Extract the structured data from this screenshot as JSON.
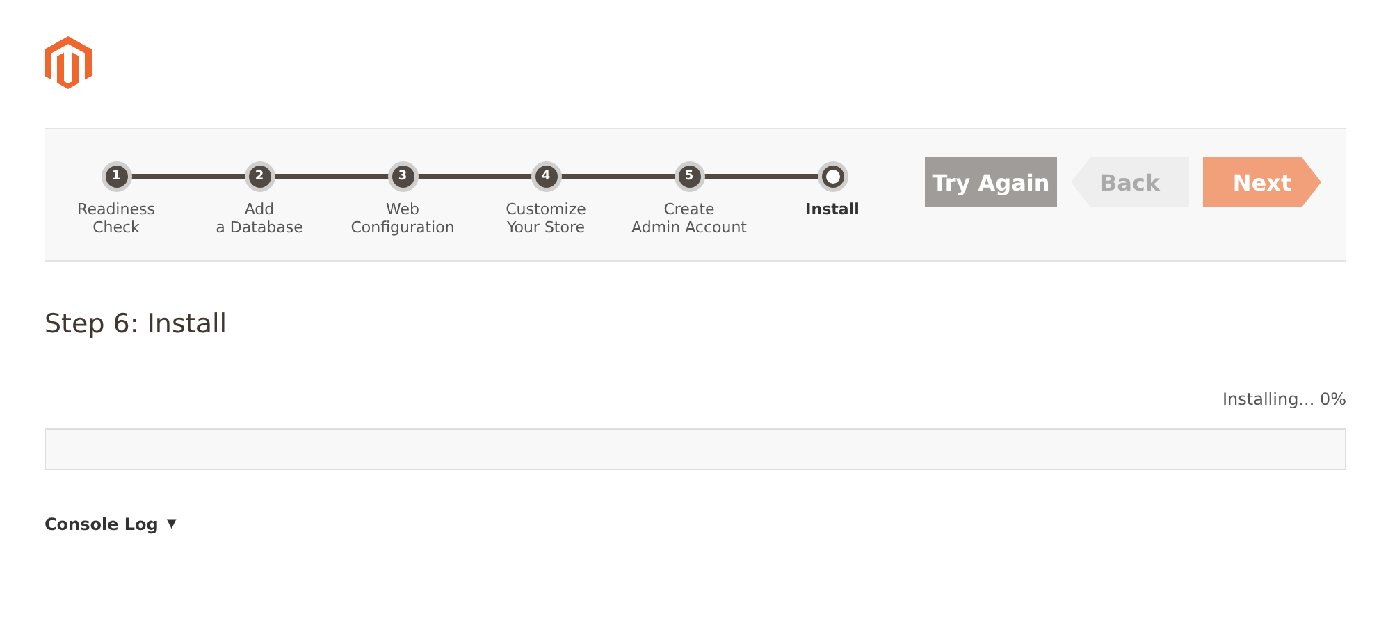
{
  "steps": [
    {
      "number": "1",
      "label": "Readiness\nCheck",
      "selected": false
    },
    {
      "number": "2",
      "label": "Add\na Database",
      "selected": false
    },
    {
      "number": "3",
      "label": "Web\nConfiguration",
      "selected": false
    },
    {
      "number": "4",
      "label": "Customize\nYour Store",
      "selected": false
    },
    {
      "number": "5",
      "label": "Create\nAdmin Account",
      "selected": false
    },
    {
      "label": "Install",
      "selected": true
    }
  ],
  "buttons": [
    {
      "kind": "retry",
      "label": "Try Again"
    },
    {
      "kind": "back",
      "label": "Back"
    },
    {
      "kind": "next",
      "label": "Next"
    }
  ],
  "title": "Step 6: Install",
  "progress": {
    "status": "Installing... 0%",
    "level": 0
  },
  "console_log": {
    "label": "Console Log",
    "toggle": "▼"
  }
}
